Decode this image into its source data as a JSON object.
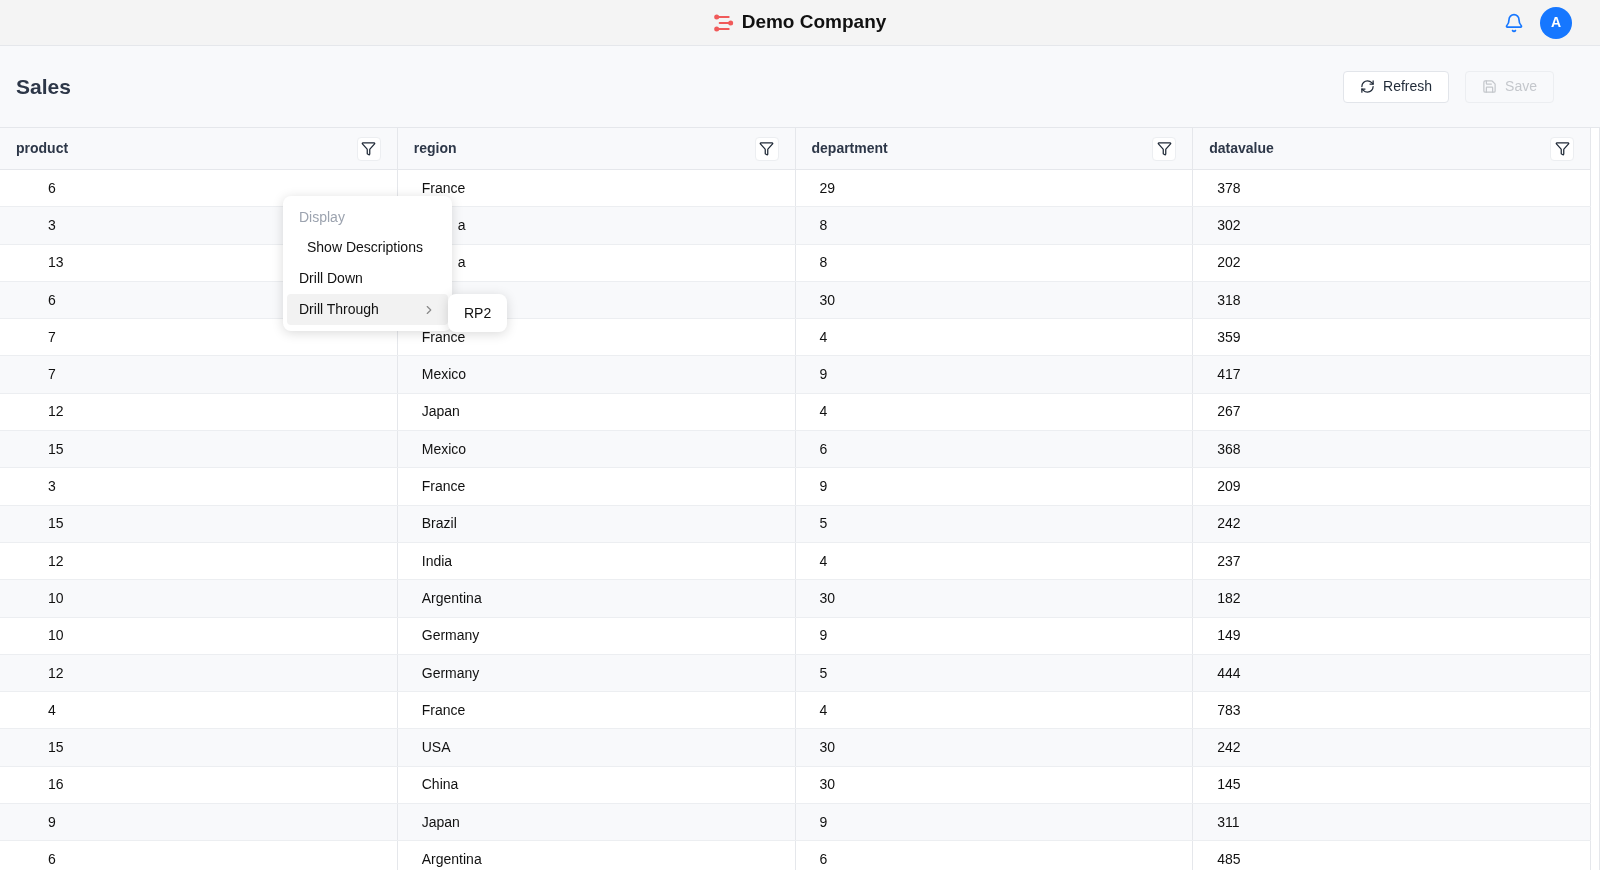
{
  "header": {
    "company": "Demo Company",
    "avatar": "A"
  },
  "page": {
    "title": "Sales",
    "buttons": [
      {
        "label": "Refresh",
        "kind": "refresh",
        "disabled": false
      },
      {
        "label": "Save",
        "kind": "save",
        "disabled": true
      }
    ]
  },
  "table": {
    "columns": [
      "product",
      "region",
      "department",
      "datavalue"
    ],
    "rows": [
      {
        "cells": [
          "6",
          "France",
          "29",
          "378"
        ]
      },
      {
        "cells": [
          "3",
          "a",
          "8",
          "302"
        ],
        "covered": true
      },
      {
        "cells": [
          "13",
          "a",
          "8",
          "202"
        ],
        "covered": true
      },
      {
        "cells": [
          "6",
          null,
          "30",
          "318"
        ]
      },
      {
        "cells": [
          "7",
          "France",
          "4",
          "359"
        ]
      },
      {
        "cells": [
          "7",
          "Mexico",
          "9",
          "417"
        ]
      },
      {
        "cells": [
          "12",
          "Japan",
          "4",
          "267"
        ]
      },
      {
        "cells": [
          "15",
          "Mexico",
          "6",
          "368"
        ]
      },
      {
        "cells": [
          "3",
          "France",
          "9",
          "209"
        ]
      },
      {
        "cells": [
          "15",
          "Brazil",
          "5",
          "242"
        ]
      },
      {
        "cells": [
          "12",
          "India",
          "4",
          "237"
        ]
      },
      {
        "cells": [
          "10",
          "Argentina",
          "30",
          "182"
        ]
      },
      {
        "cells": [
          "10",
          "Germany",
          "9",
          "149"
        ]
      },
      {
        "cells": [
          "12",
          "Germany",
          "5",
          "444"
        ]
      },
      {
        "cells": [
          "4",
          "France",
          "4",
          "783"
        ]
      },
      {
        "cells": [
          "15",
          "USA",
          "30",
          "242"
        ]
      },
      {
        "cells": [
          "16",
          "China",
          "30",
          "145"
        ]
      },
      {
        "cells": [
          "9",
          "Japan",
          "9",
          "311"
        ]
      },
      {
        "cells": [
          "6",
          "Argentina",
          "6",
          "485"
        ]
      }
    ]
  },
  "context_menu": {
    "items": [
      {
        "label": "Display",
        "kind": "group",
        "selected": false,
        "children": [
          {
            "label": "Show Descriptions",
            "selected": false
          }
        ]
      },
      {
        "label": "Drill Down",
        "kind": "item",
        "selected": false
      },
      {
        "label": "Drill Through",
        "kind": "submenu",
        "selected": true,
        "submenu": [
          "RP2"
        ]
      }
    ]
  }
}
